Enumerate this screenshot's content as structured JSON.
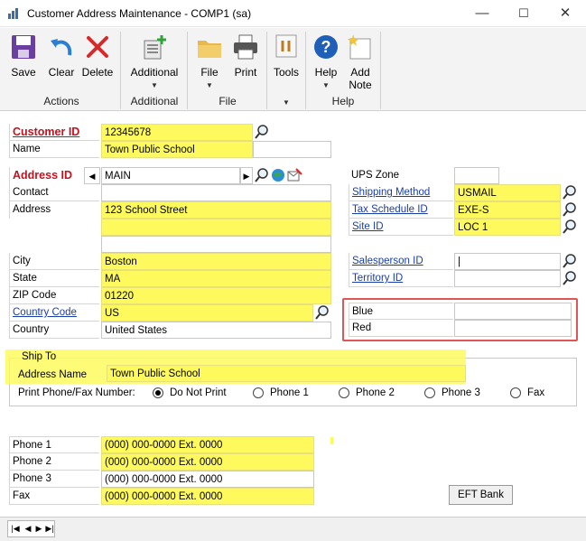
{
  "window": {
    "title": "Customer Address Maintenance  -  COMP1 (sa)",
    "minimize": "—",
    "maximize": "☐",
    "close": "✕"
  },
  "ribbon": {
    "actions": {
      "save": "Save",
      "clear": "Clear",
      "delete": "Delete",
      "group": "Actions"
    },
    "additional": {
      "button": "Additional",
      "group": "Additional"
    },
    "file": {
      "file": "File",
      "print": "Print",
      "group": "File"
    },
    "tools": {
      "button": "Tools"
    },
    "help": {
      "help": "Help",
      "add_note_1": "Add",
      "add_note_2": "Note",
      "group": "Help"
    }
  },
  "customer": {
    "id_label": "Customer ID",
    "id_value": "12345678",
    "name_label": "Name",
    "name_value": "Town Public School"
  },
  "address": {
    "id_label": "Address ID",
    "id_value": "MAIN",
    "contact_label": "Contact",
    "contact_value": "",
    "address_label": "Address",
    "address_line1": "123 School Street",
    "address_line2": "",
    "address_line3": "",
    "city_label": "City",
    "city_value": "Boston",
    "state_label": "State",
    "state_value": "MA",
    "zip_label": "ZIP Code",
    "zip_value": "01220",
    "country_code_label": "Country Code",
    "country_code_value": "US",
    "country_label": "Country",
    "country_value": "United States"
  },
  "right": {
    "ups_zone_label": "UPS Zone",
    "ups_zone_value": "",
    "shipping_method_label": "Shipping Method",
    "shipping_method_value": "USMAIL",
    "tax_schedule_label": "Tax Schedule ID",
    "tax_schedule_value": "EXE-S",
    "site_id_label": "Site ID",
    "site_id_value": "LOC 1",
    "salesperson_label": "Salesperson ID",
    "salesperson_value": "|",
    "territory_label": "Territory ID",
    "territory_value": "",
    "blue_label": "Blue",
    "blue_value": "",
    "red_label": "Red",
    "red_value": ""
  },
  "ship_to": {
    "group_label": "Ship To",
    "address_name_label": "Address Name",
    "address_name_value": "Town Public School",
    "print_label": "Print Phone/Fax Number:",
    "options": [
      "Do Not Print",
      "Phone 1",
      "Phone 2",
      "Phone 3",
      "Fax"
    ],
    "selected": "Do Not Print"
  },
  "phones": {
    "phone1_label": "Phone 1",
    "phone1_value": "(000) 000-0000  Ext. 0000",
    "phone2_label": "Phone 2",
    "phone2_value": "(000) 000-0000  Ext. 0000",
    "phone3_label": "Phone 3",
    "phone3_value": "(000) 000-0000  Ext. 0000",
    "fax_label": "Fax",
    "fax_value": "(000) 000-0000  Ext. 0000"
  },
  "buttons": {
    "eft_bank": "EFT Bank"
  },
  "colors": {
    "highlight": "#fefa5e",
    "required": "#c1121f",
    "link": "#1a3ea8",
    "annotation_box": "#e05555"
  }
}
